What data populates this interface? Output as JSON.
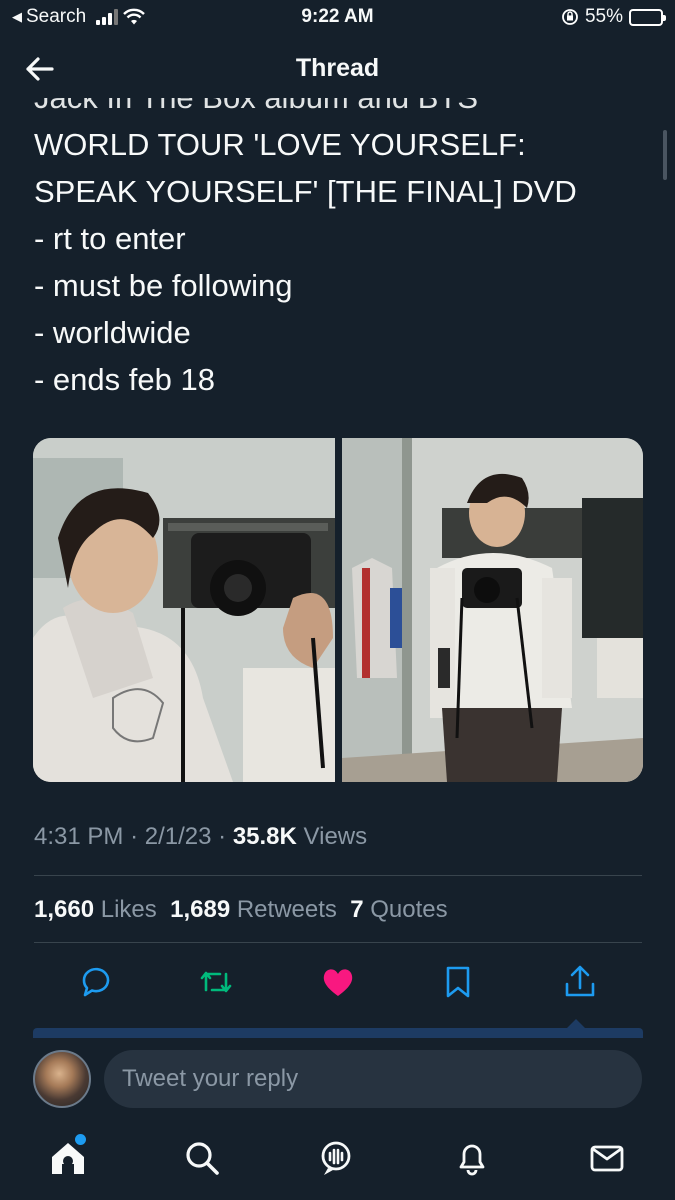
{
  "status_bar": {
    "back_app": "Search",
    "time": "9:22 AM",
    "battery_percent": "55%",
    "battery_level": 0.55
  },
  "header": {
    "title": "Thread"
  },
  "tweet": {
    "lines": [
      "WORLD TOUR 'LOVE YOURSELF:",
      "SPEAK YOURSELF' [THE FINAL] DVD",
      "- rt to enter",
      "- must be following",
      "- worldwide",
      "- ends feb 18"
    ],
    "cut_off_line": "Jack In The Box album and BTS",
    "time": "4:31 PM",
    "date": "2/1/23",
    "views_count": "35.8K",
    "views_label": "Views",
    "likes_count": "1,660",
    "likes_label": "Likes",
    "retweets_count": "1,689",
    "retweets_label": "Retweets",
    "quotes_count": "7",
    "quotes_label": "Quotes"
  },
  "reply": {
    "placeholder": "Tweet your reply"
  },
  "colors": {
    "background": "#15202b",
    "text": "#f7f9f9",
    "muted": "#8b98a5",
    "retweet": "#00ba7c",
    "like": "#f91880",
    "accent": "#1d9bf0",
    "battery": "#f4c742"
  },
  "icons": {
    "back": "arrow-left-icon",
    "reply": "comment-icon",
    "retweet": "retweet-icon",
    "like": "heart-icon",
    "bookmark": "bookmark-icon",
    "share": "share-icon",
    "home": "home-icon",
    "search": "search-icon",
    "spaces": "spaces-icon",
    "notifications": "bell-icon",
    "messages": "mail-icon"
  }
}
